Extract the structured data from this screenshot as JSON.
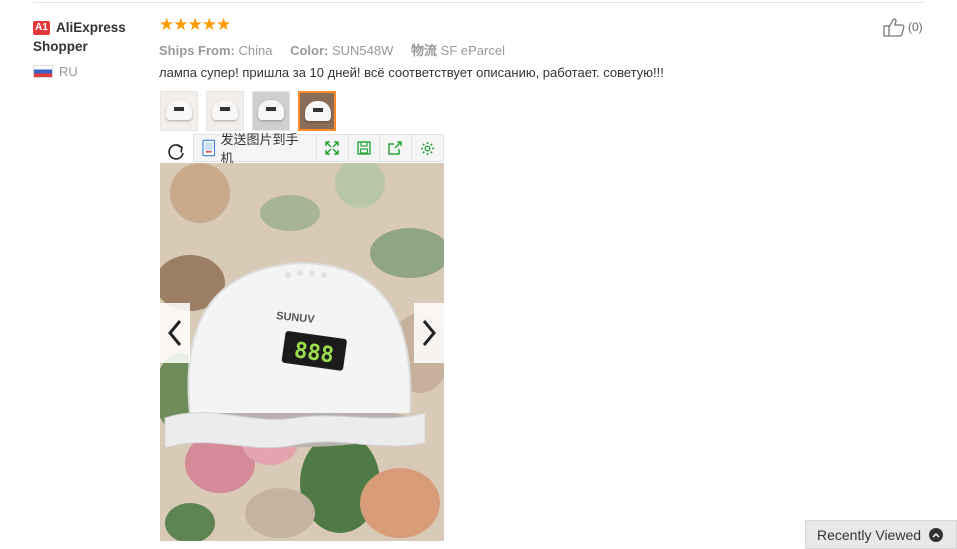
{
  "reviewer": {
    "badge": "A1",
    "name": "AliExpress Shopper",
    "country_code": "RU",
    "flag": "russia-flag"
  },
  "review": {
    "rating_stars": "★★★★★",
    "rating": 5,
    "ships_from_label": "Ships From:",
    "ships_from_value": "China",
    "color_label": "Color:",
    "color_value": "SUN548W",
    "logistics_label": "物流",
    "logistics_value": "SF eParcel",
    "text": "лампа супер! пришла за 10 дней! всё соответствует описанию, работает. советую!!!"
  },
  "helpful": {
    "count": "(0)",
    "icon": "thumbs-up-icon"
  },
  "thumbnails": [
    {
      "name": "photo-1",
      "active": false
    },
    {
      "name": "photo-2",
      "active": false
    },
    {
      "name": "photo-3",
      "active": false
    },
    {
      "name": "photo-4",
      "active": true
    }
  ],
  "image_toolbar": {
    "send_to_phone": "发送图片到手机",
    "icons": [
      "rotate-icon",
      "send-to-phone-icon",
      "fullscreen-icon",
      "save-icon",
      "share-icon",
      "settings-icon"
    ]
  },
  "main_image": {
    "device_brand": "SUNUV",
    "display_reading": "888"
  },
  "colors": {
    "star": "#ff9a00",
    "badge": "#e4393c",
    "toolbar_icon": "#2aa53b",
    "active_thumb": "#ff8a2a"
  },
  "recently_viewed": {
    "label": "Recently Viewed"
  }
}
